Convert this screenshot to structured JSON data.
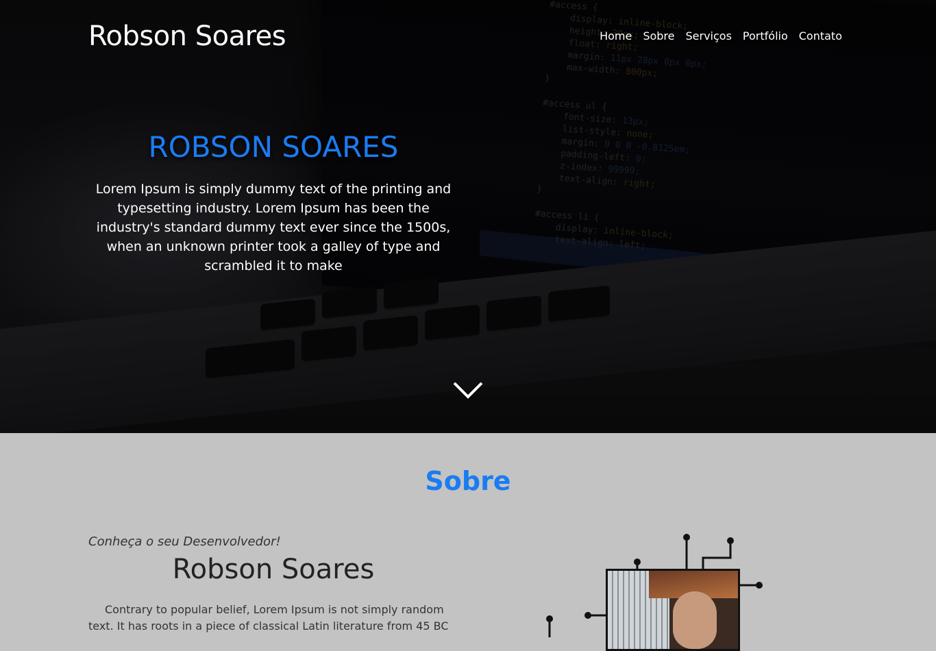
{
  "header": {
    "brand": "Robson Soares",
    "nav": [
      {
        "label": "Home"
      },
      {
        "label": "Sobre"
      },
      {
        "label": "Serviços"
      },
      {
        "label": "Portfólio"
      },
      {
        "label": "Contato"
      }
    ]
  },
  "hero": {
    "title": "ROBSON SOARES",
    "text": "Lorem Ipsum is simply dummy text of the printing and typesetting industry. Lorem Ipsum has been the industry's standard dummy text ever since the 1500s, when an unknown printer took a galley of type and scrambled it to make",
    "scroll_icon": "chevron-down-icon"
  },
  "sobre": {
    "title": "Sobre",
    "tagline": "Conheça o seu Desenvolvedor!",
    "name": "Robson Soares",
    "text": "Contrary to popular belief, Lorem Ipsum is not simply random text. It has roots in a piece of classical Latin literature from 45 BC"
  },
  "colors": {
    "accent": "#1a7cf2",
    "section_bg": "#c3c3c3",
    "text_dark": "#222222"
  }
}
